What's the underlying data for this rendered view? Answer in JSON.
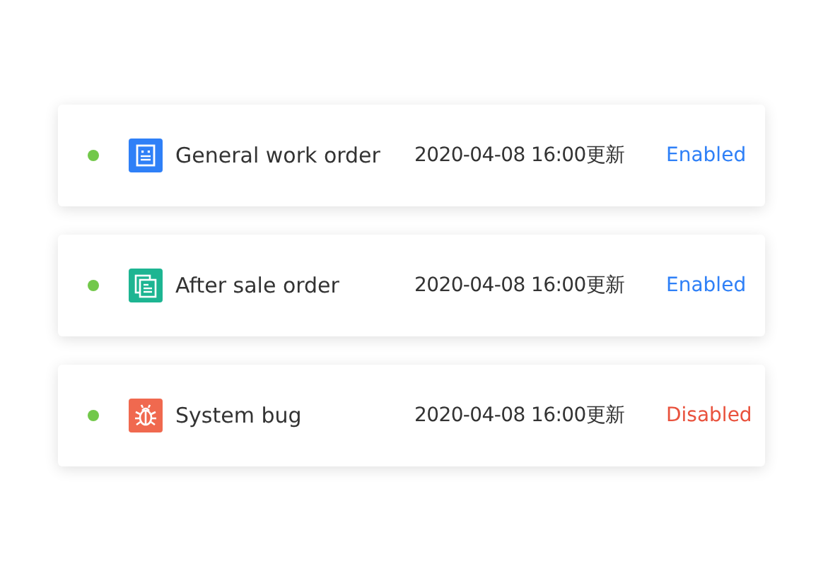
{
  "orders": [
    {
      "color": "#72c84a",
      "kind": "document",
      "name": "General work order",
      "time": "2020-04-08 16:00更新",
      "enabled": true,
      "status": "Enabled"
    },
    {
      "color": "#72c84a",
      "kind": "copy",
      "name": "After sale order",
      "time": "2020-04-08 16:00更新",
      "enabled": true,
      "status": "Enabled"
    },
    {
      "color": "#72c84a",
      "kind": "bug",
      "name": "System bug",
      "time": "2020-04-08 16:00更新",
      "enabled": false,
      "status": "Disabled"
    }
  ]
}
